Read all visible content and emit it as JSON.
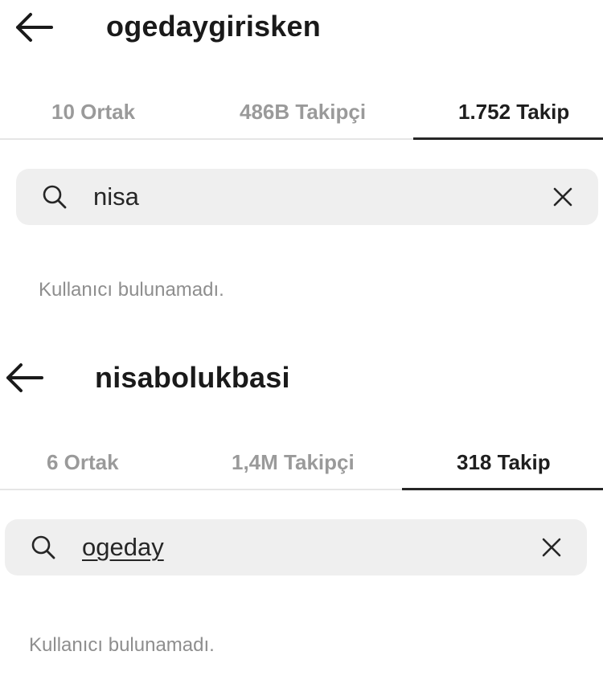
{
  "screens": [
    {
      "username": "ogedaygirisken",
      "tabs": [
        {
          "label": "10 Ortak"
        },
        {
          "label": "486B Takipçi"
        },
        {
          "label": "1.752 Takip",
          "active": true
        }
      ],
      "search": {
        "value": "nisa",
        "search_icon": "search-icon",
        "clear_icon": "close-icon"
      },
      "empty_message": "Kullanıcı bulunamadı."
    },
    {
      "username": "nisabolukbasi",
      "tabs": [
        {
          "label": "6 Ortak"
        },
        {
          "label": "1,4M Takipçi"
        },
        {
          "label": "318 Takip",
          "active": true
        }
      ],
      "search": {
        "value": "ogeday",
        "search_icon": "search-icon",
        "clear_icon": "close-icon"
      },
      "empty_message": "Kullanıcı bulunamadı."
    }
  ],
  "colors": {
    "background": "#ffffff",
    "search_bg": "#efefef",
    "tab_inactive": "#9a9a9a",
    "tab_active": "#1e1e1e",
    "muted_text": "#8e8e8e"
  }
}
